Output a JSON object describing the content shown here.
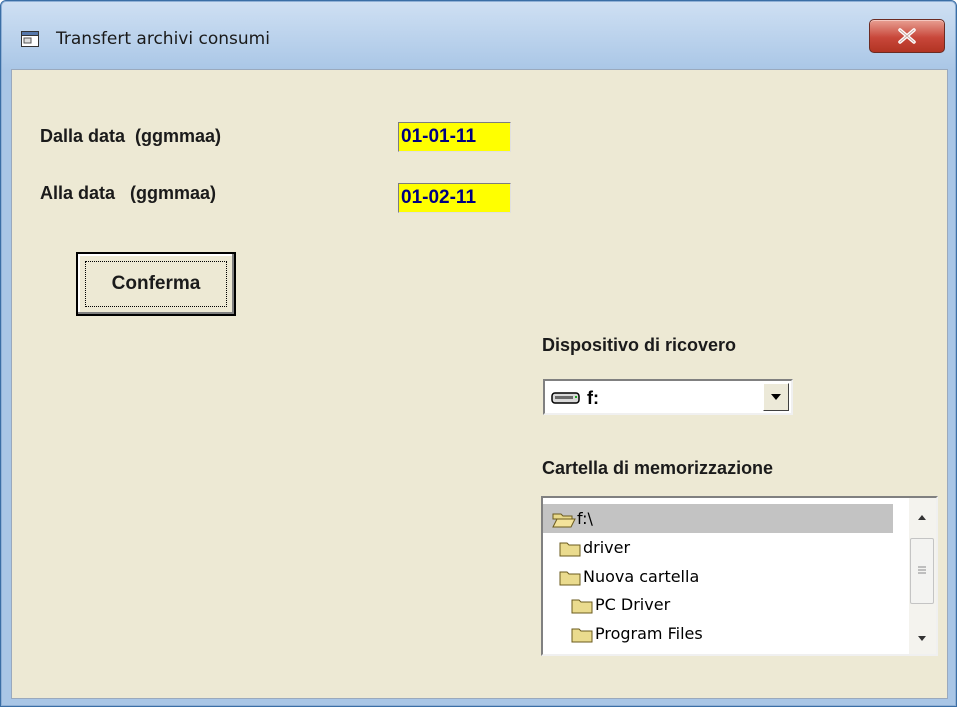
{
  "window": {
    "title": "Transfert archivi consumi",
    "close_label": "X"
  },
  "form": {
    "from_label": "Dalla data  (ggmmaa)",
    "from_value": "01-01-11",
    "to_label": "Alla data   (ggmmaa)",
    "to_value": "01-02-11",
    "confirm_label": "Conferma"
  },
  "drive": {
    "label": "Dispositivo di ricovero",
    "value": "f:",
    "icon": "drive-icon"
  },
  "folders": {
    "label": "Cartella di memorizzazione",
    "items": [
      {
        "name": "f:\\",
        "icon": "open-folder-icon",
        "selected": true
      },
      {
        "name": "driver",
        "icon": "folder-icon"
      },
      {
        "name": "Nuova cartella",
        "icon": "folder-icon"
      },
      {
        "name": "PC Driver",
        "icon": "folder-icon"
      },
      {
        "name": "Program Files",
        "icon": "folder-icon"
      }
    ]
  },
  "colors": {
    "dialog_bg": "#ede9d4",
    "date_field_bg": "#ffff00",
    "date_field_text": "#000080",
    "close_button": "#c8473a"
  }
}
